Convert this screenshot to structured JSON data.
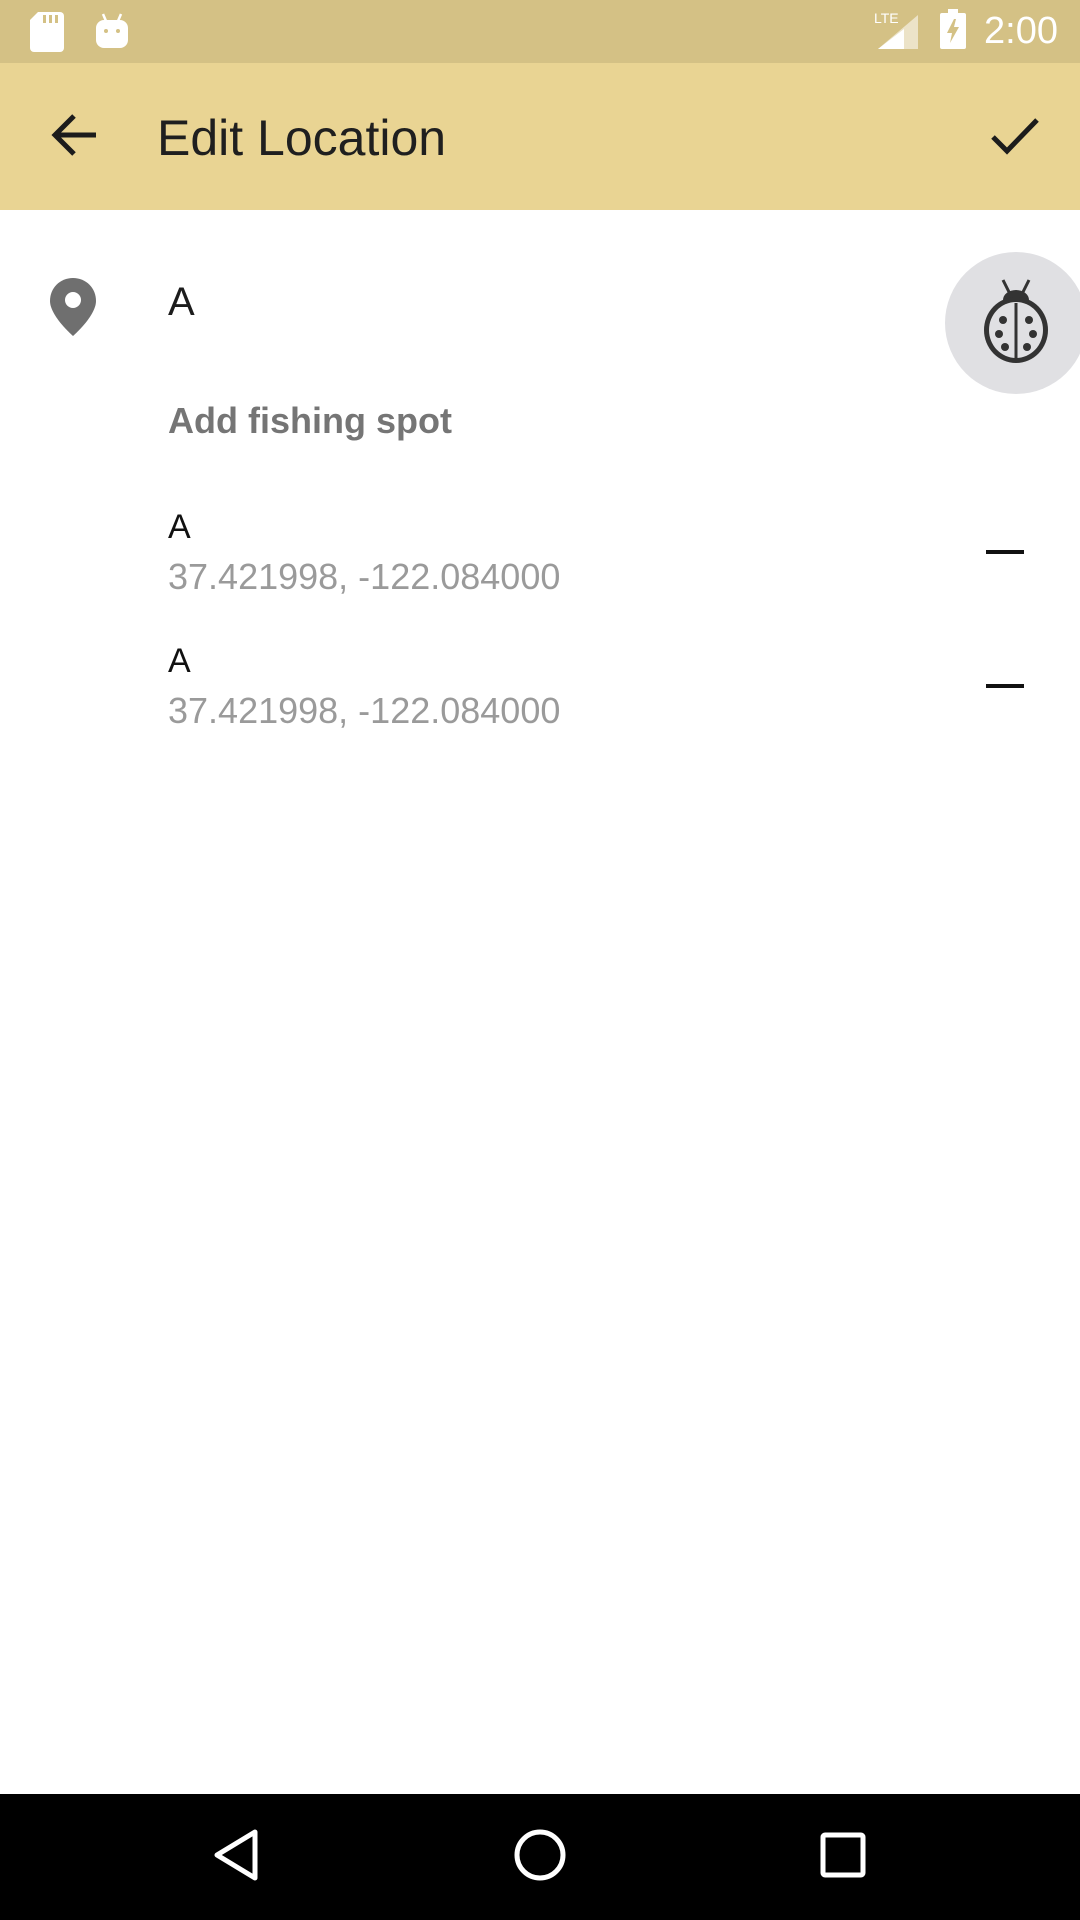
{
  "status_bar": {
    "time": "2:00",
    "left_icons": [
      "sd-card-icon",
      "android-icon"
    ],
    "right_icons": [
      "lte-signal-icon",
      "battery-charging-icon"
    ]
  },
  "app_bar": {
    "title": "Edit Location",
    "back_icon": "arrow-back-icon",
    "confirm_icon": "check-icon"
  },
  "location": {
    "name_value": "A",
    "pin_icon": "location-pin-icon"
  },
  "fab": {
    "icon": "ladybug-icon"
  },
  "add_fishing_spot_label": "Add fishing spot",
  "fishing_spots": [
    {
      "name": "A",
      "coords": "37.421998, -122.084000"
    },
    {
      "name": "A",
      "coords": "37.421998, -122.084000"
    }
  ],
  "nav_bar": {
    "icons": [
      "back-triangle-icon",
      "home-circle-icon",
      "recents-square-icon"
    ]
  },
  "colors": {
    "status_bar": "#d4c185",
    "app_bar": "#e9d493",
    "fab_background": "#e0e0e3",
    "secondary_text": "#9a9a9a"
  }
}
